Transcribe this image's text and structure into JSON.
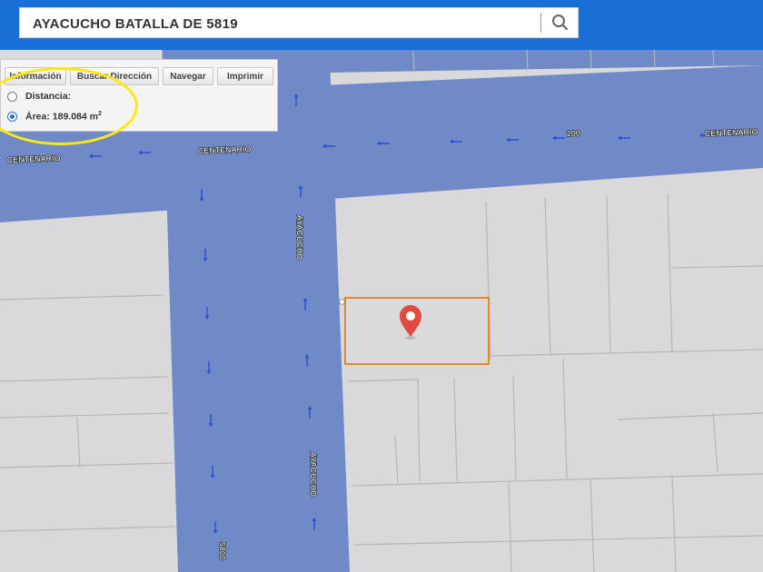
{
  "search": {
    "value": "AYACUCHO BATALLA DE 5819",
    "icon": "search-icon"
  },
  "toolbar": {
    "buttons": [
      {
        "label": "Información"
      },
      {
        "label": "Buscar Dirección"
      },
      {
        "label": "Navegar"
      },
      {
        "label": "Imprimir"
      }
    ],
    "options": [
      {
        "label": "Distancia:",
        "checked": false
      },
      {
        "label": "Área: 189.084 m",
        "unit_sup": "2",
        "checked": true
      }
    ]
  },
  "map": {
    "street_labels": {
      "centenario_left": "CENTENARIO",
      "centenario_mid": "CENTENARIO",
      "centenario_right": "CENTENARIO",
      "ayacucho_top": "AYACUCHO",
      "ayacucho_bottom": "AYACUCHO",
      "number_200": "200",
      "number_5800": "5800"
    },
    "marker": "location-pin-icon"
  },
  "colors": {
    "header": "#1a6fd6",
    "street": "#6f8ac6",
    "parcel": "#d9d9dc",
    "selected_parcel_border": "#e28a2a",
    "marker": "#e04a3f",
    "highlight": "#ffe812"
  }
}
